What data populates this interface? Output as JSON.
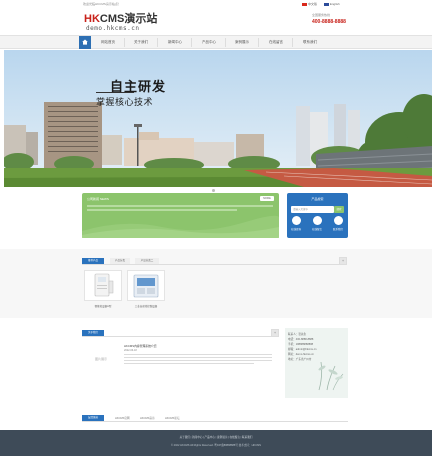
{
  "top": {
    "tagline": "欢迎光临HKCMS演示站点！",
    "logo_mark": "HK",
    "logo_rest": "CMS演示站",
    "logo_sub": "demo.hkcms.cn",
    "lang_cn": "中文版",
    "lang_en": "English",
    "hotline_label": "全国服务热线",
    "hotline": "400-8888-8888"
  },
  "nav": {
    "items": [
      "网站首页",
      "关于我们",
      "新闻中心",
      "产品中心",
      "案例展示",
      "在线留言",
      "联系我们"
    ]
  },
  "banner": {
    "title": "自主研发",
    "subtitle": "掌握核心技术"
  },
  "news": {
    "title": "公司新闻 NEWS",
    "more": "MORE"
  },
  "product_panel": {
    "title": "产品搜索",
    "search_placeholder": "请输入关键字",
    "search_button": "搜索",
    "quick": [
      "在线咨询",
      "在线留言",
      "联系我们"
    ]
  },
  "products": {
    "tag": "推荐产品",
    "tabs": [
      "产品分类",
      "产品分类二"
    ],
    "more": "+",
    "items": [
      {
        "caption": "智能化设备A型"
      },
      {
        "caption": "工业自动化控制设备"
      }
    ]
  },
  "about": {
    "tag": "关于我们",
    "more": "+",
    "img_alt": "图片展示",
    "item_title": "HKCMS内容管理系统介绍",
    "item_date": "2022-06-18"
  },
  "contact": {
    "lines": [
      "联系人：张先生",
      "电话：400-8888-8888",
      "手机：188888888888",
      "邮箱：admin@hkcms.cn",
      "网址：demo.hkcms.cn",
      "地址：广东省广州市"
    ]
  },
  "links": {
    "tag": "友情链接",
    "items": [
      "HKCMS官网",
      "HKCMS演示",
      "HKCMS论坛"
    ]
  },
  "footer": {
    "nav": "关于我们 | 新闻中心 | 产品中心 | 案例展示 | 在线留言 | 联系我们",
    "copyright": "© 2022 HKCMS All Rights Reserved. 粤ICP备88888888号 技术支持：HKCMS"
  },
  "colors": {
    "accent_blue": "#2a72bd",
    "accent_green": "#8cc46c",
    "brand_red": "#c8211a",
    "footer_bg": "#3e4b58"
  }
}
